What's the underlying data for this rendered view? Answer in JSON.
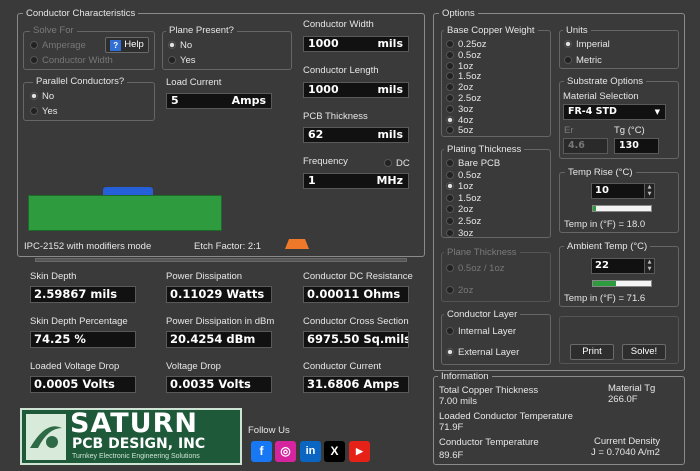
{
  "conductor": {
    "title": "Conductor Characteristics",
    "solve_for": {
      "legend": "Solve For",
      "options": [
        "Amperage",
        "Conductor Width"
      ],
      "help": "Help",
      "help_icon": "?"
    },
    "plane_present": {
      "legend": "Plane Present?",
      "options": [
        "No",
        "Yes"
      ]
    },
    "parallel": {
      "legend": "Parallel Conductors?",
      "options": [
        "No",
        "Yes"
      ]
    },
    "load_current": {
      "label": "Load Current",
      "value": "5",
      "unit": "Amps"
    },
    "width": {
      "label": "Conductor Width",
      "value": "1000",
      "unit": "mils"
    },
    "length": {
      "label": "Conductor Length",
      "value": "1000",
      "unit": "mils"
    },
    "thickness": {
      "label": "PCB Thickness",
      "value": "62",
      "unit": "mils"
    },
    "frequency": {
      "label": "Frequency",
      "value": "1",
      "unit": "MHz",
      "dc_label": "DC"
    },
    "mode_text": "IPC-2152 with modifiers mode",
    "etch_factor": "Etch Factor: 2:1",
    "colors": {
      "board": "#2e9c3e",
      "trace": "#2560d8",
      "etch": "#f0782a"
    }
  },
  "results": {
    "skin_depth": {
      "label": "Skin Depth",
      "value": "2.59867 mils"
    },
    "power_dissipation": {
      "label": "Power Dissipation",
      "value": "0.11029 Watts"
    },
    "dc_resistance": {
      "label": "Conductor DC Resistance",
      "value": "0.00011 Ohms"
    },
    "skin_depth_pct": {
      "label": "Skin Depth Percentage",
      "value": "74.25 %"
    },
    "power_dbm": {
      "label": "Power Dissipation in dBm",
      "value": "20.4254 dBm"
    },
    "cross_section": {
      "label": "Conductor Cross Section",
      "value": "6975.50 Sq.mils"
    },
    "loaded_vdrop": {
      "label": "Loaded Voltage Drop",
      "value": "0.0005 Volts"
    },
    "vdrop": {
      "label": "Voltage Drop",
      "value": "0.0035 Volts"
    },
    "current": {
      "label": "Conductor Current",
      "value": "31.6806 Amps"
    }
  },
  "logo": {
    "line1": "SATURN",
    "line2": "PCB DESIGN, INC",
    "line3": "Turnkey Electronic Engineering Solutions"
  },
  "social": {
    "label": "Follow Us",
    "icons": [
      {
        "name": "facebook-icon",
        "glyph": "f",
        "color": "#1877f2"
      },
      {
        "name": "instagram-icon",
        "glyph": "◎",
        "color": "#d6249f"
      },
      {
        "name": "linkedin-icon",
        "glyph": "in",
        "color": "#0a66c2"
      },
      {
        "name": "x-icon",
        "glyph": "X",
        "color": "#000000"
      },
      {
        "name": "youtube-icon",
        "glyph": "▶",
        "color": "#e62117"
      }
    ]
  },
  "options": {
    "title": "Options",
    "copper_weight": {
      "legend": "Base Copper Weight",
      "options": [
        "0.25oz",
        "0.5oz",
        "1oz",
        "1.5oz",
        "2oz",
        "2.5oz",
        "3oz",
        "4oz",
        "5oz"
      ],
      "selected_index": 7
    },
    "plating": {
      "legend": "Plating Thickness",
      "options": [
        "Bare PCB",
        "0.5oz",
        "1oz",
        "1.5oz",
        "2oz",
        "2.5oz",
        "3oz"
      ],
      "selected_index": 2
    },
    "plane_thickness": {
      "legend": "Plane Thickness",
      "options": [
        "0.5oz / 1oz",
        "2oz"
      ]
    },
    "conductor_layer": {
      "legend": "Conductor Layer",
      "options": [
        "Internal Layer",
        "External Layer"
      ]
    },
    "units": {
      "legend": "Units",
      "options": [
        "Imperial",
        "Metric"
      ]
    },
    "substrate": {
      "legend": "Substrate Options",
      "material_label": "Material Selection",
      "material_value": "FR-4 STD",
      "er_label": "Er",
      "er_value": "4.6",
      "tg_label": "Tg (°C)",
      "tg_value": "130"
    },
    "temp_rise": {
      "legend": "Temp Rise (°C)",
      "value": "10",
      "fahrenheit": "Temp in (°F) = 18.0",
      "level": 0.05
    },
    "ambient": {
      "legend": "Ambient Temp (°C)",
      "value": "22",
      "fahrenheit": "Temp in (°F) = 71.6",
      "level": 0.4
    },
    "print_label": "Print",
    "solve_label": "Solve!"
  },
  "information": {
    "title": "Information",
    "total_copper_label": "Total Copper Thickness",
    "total_copper_value": "7.00 mils",
    "material_tg_label": "Material Tg",
    "material_tg_value": "266.0F",
    "loaded_temp_label": "Loaded Conductor Temperature",
    "loaded_temp_value": "71.9F",
    "cond_temp_label": "Conductor Temperature",
    "cond_temp_value": "89.6F",
    "current_density_label": "Current Density",
    "current_density_value": "J = 0.7040 A/m2"
  }
}
